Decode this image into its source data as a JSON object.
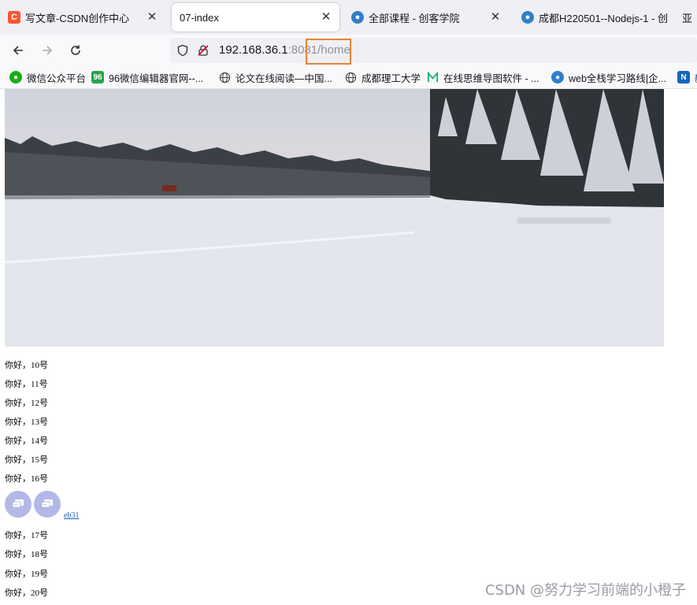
{
  "tabs": [
    {
      "title": "写文章-CSDN创作中心",
      "icon": "csdn-icon",
      "active": false
    },
    {
      "title": "07-index",
      "icon": "none",
      "active": true
    },
    {
      "title": "全部课程 - 创客学院",
      "icon": "makerschool-icon",
      "active": false
    },
    {
      "title": "成都H220501--Nodejs-1 - 创",
      "icon": "makerschool-icon",
      "active": false
    },
    {
      "title": "亚",
      "icon": "none",
      "active": false
    }
  ],
  "address": {
    "host": "192.168.36.1",
    "port": ":8081",
    "path": "/home"
  },
  "bookmarks": [
    {
      "label": "微信公众平台",
      "icon": "wechat-icon"
    },
    {
      "label": "96微信编辑器官网--...",
      "icon": "96-icon",
      "icon_text": "96"
    },
    {
      "label": "论文在线阅读—中国...",
      "icon": "globe-icon"
    },
    {
      "label": "成都理工大学",
      "icon": "globe-icon"
    },
    {
      "label": "在线思维导图软件 - ...",
      "icon": "mindmap-icon"
    },
    {
      "label": "web全栈学习路线|企...",
      "icon": "makerschool-icon"
    },
    {
      "label": "新",
      "icon": "n-icon",
      "icon_text": "N"
    }
  ],
  "content": {
    "lines_a": [
      "你好，10号",
      "你好，11号",
      "你好，12号",
      "你好，13号",
      "你好，14号",
      "你好，15号",
      "你好，16号"
    ],
    "link": "eb31",
    "lines_b": [
      "你好，17号",
      "你好，18号",
      "你好，19号",
      "你好，20号"
    ]
  },
  "watermark": "CSDN @努力学习前端的小橙子",
  "colors": {
    "highlight": "#e8843b",
    "avatar": "#b3b8e6",
    "csdn": "#fc5531"
  }
}
